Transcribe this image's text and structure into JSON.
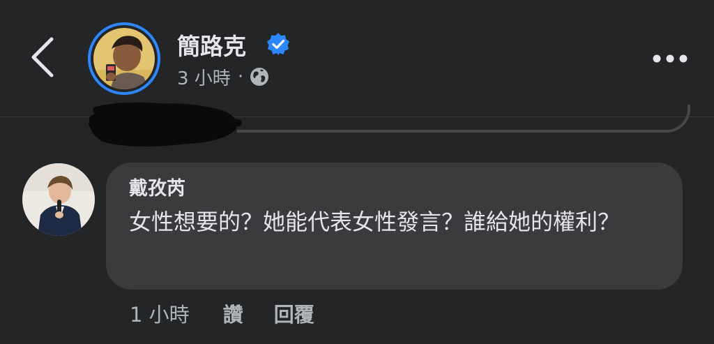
{
  "post_header": {
    "author_name": "簡路克",
    "time_ago": "3 小時",
    "separator": "·",
    "audience_icon": "globe-icon",
    "verified_icon": "verified-badge-icon",
    "back_icon": "chevron-left-icon",
    "more_icon": "more-horizontal-icon"
  },
  "comment": {
    "author_name": "戴孜芮",
    "text": "女性想要的？她能代表女性發言？誰給她的權利？",
    "time_ago": "1 小時",
    "like_label": "讚",
    "reply_label": "回覆"
  },
  "colors": {
    "background": "#242527",
    "bubble": "#3a3b3c",
    "primary_text": "#e4e6eb",
    "secondary_text": "#b0b3b8",
    "accent_blue": "#2d88ff"
  }
}
